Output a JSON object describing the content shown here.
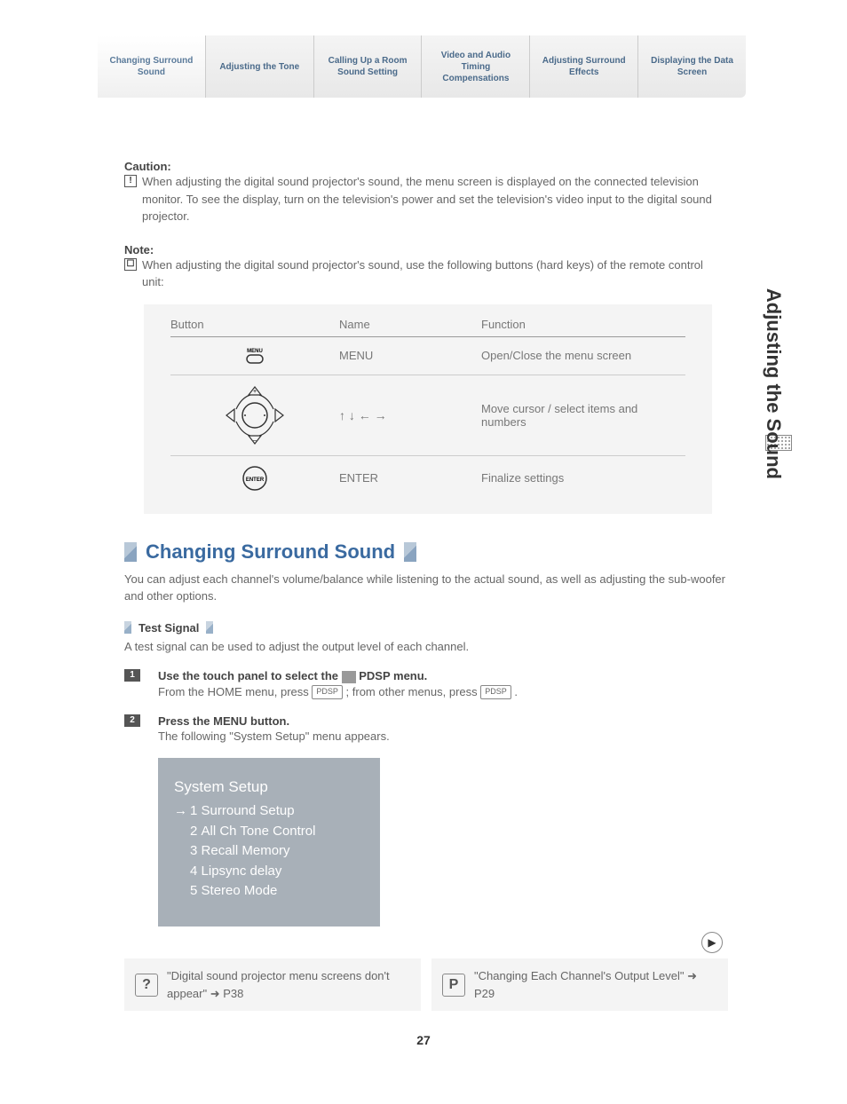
{
  "tabs": [
    {
      "label": "Changing Surround Sound",
      "active": true
    },
    {
      "label": "Adjusting the Tone",
      "active": false
    },
    {
      "label": "Calling Up a Room Sound Setting",
      "active": false
    },
    {
      "label": "Video and Audio Timing Compensations",
      "active": false
    },
    {
      "label": "Adjusting Surround Effects",
      "active": false
    },
    {
      "label": "Displaying the Data Screen",
      "active": false
    }
  ],
  "caution": {
    "title": "Caution:",
    "body": "When adjusting the digital sound projector's sound, the menu screen is displayed on the connected television monitor. To see the display, turn on the television's power and set the television's video input to the digital sound projector."
  },
  "note": {
    "title": "Note:",
    "body": "When adjusting the digital sound projector's sound, use the following buttons (hard keys) of the remote control unit:"
  },
  "table": {
    "h1": "Button",
    "h2": "Name",
    "h3": "Function",
    "rows": [
      {
        "name": "MENU",
        "func": "Open/Close the menu screen"
      },
      {
        "name": "↑ ↓ ← →",
        "func": "Move cursor / select items and numbers"
      },
      {
        "name": "ENTER",
        "func": "Finalize settings"
      }
    ]
  },
  "section": {
    "title": "Changing Surround Sound",
    "intro": "You can adjust each channel's volume/balance while listening to the actual sound, as well as adjusting the sub-woofer and other options."
  },
  "subsection": {
    "title": "Test Signal",
    "intro": "A test signal can be used to adjust the output level of each channel."
  },
  "steps": [
    {
      "num": "1",
      "bold_pre": "Use the touch panel to select the ",
      "bold_post": " PDSP menu.",
      "body_pre": "From the HOME menu, press ",
      "key1": "PDSP",
      "body_mid": "; from other menus, press ",
      "key2": "PDSP",
      "body_post": "."
    },
    {
      "num": "2",
      "bold": "Press the MENU button.",
      "body": "The following \"System Setup\" menu appears."
    }
  ],
  "system_setup": {
    "title": "System Setup",
    "items": [
      {
        "n": "1",
        "label": "Surround Setup",
        "selected": true
      },
      {
        "n": "2",
        "label": "All Ch Tone Control",
        "selected": false
      },
      {
        "n": "3",
        "label": "Recall Memory",
        "selected": false
      },
      {
        "n": "4",
        "label": "Lipsync delay",
        "selected": false
      },
      {
        "n": "5",
        "label": "Stereo Mode",
        "selected": false
      }
    ]
  },
  "refs": [
    {
      "icon": "?",
      "text": "\"Digital sound projector menu screens don't appear\" ➜ P38"
    },
    {
      "icon": "P",
      "text": "\"Changing Each Channel's Output Level\" ➜ P29"
    }
  ],
  "page_number": "27",
  "side_label": "Adjusting the Sound"
}
